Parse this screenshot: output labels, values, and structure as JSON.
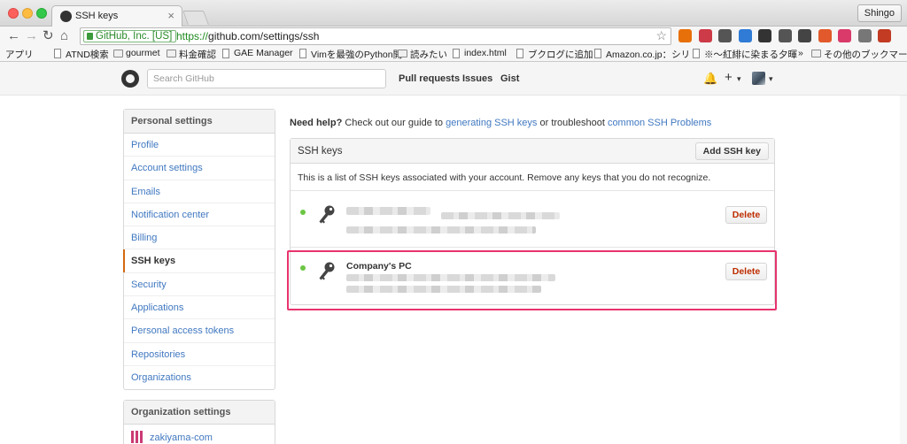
{
  "browser": {
    "tab_title": "SSH keys",
    "profile": "Shingo",
    "ev_label": "GitHub, Inc. [US]",
    "url_scheme": "https://",
    "url_rest": "github.com/settings/ssh",
    "extensions": [
      "ghostery-icon",
      "pocket-icon",
      "w-icon",
      "vimium-icon",
      "gear-icon",
      "cast-icon",
      "window-icon",
      "app-icon",
      "notes-icon",
      "evernote-icon",
      "gmail-icon",
      "boot-icon"
    ],
    "bookmarks": [
      {
        "label": "アプリ",
        "kind": "apps"
      },
      {
        "label": "ATND検索",
        "kind": "page"
      },
      {
        "label": "gourmet",
        "kind": "folder"
      },
      {
        "label": "料金確認",
        "kind": "folder"
      },
      {
        "label": "GAE Manager",
        "kind": "page"
      },
      {
        "label": "Vimを最強のPython開",
        "kind": "page"
      },
      {
        "label": "読みたい",
        "kind": "folder"
      },
      {
        "label": "index.html",
        "kind": "page"
      },
      {
        "label": "ブクログに追加",
        "kind": "page"
      },
      {
        "label": "Amazon.co.jp：シリ",
        "kind": "page"
      },
      {
        "label": "※〜紅緋に染まる夕暉",
        "kind": "page"
      },
      {
        "label": "»",
        "kind": "more"
      },
      {
        "label": "その他のブックマーク",
        "kind": "folder"
      }
    ]
  },
  "header": {
    "search_placeholder": "Search GitHub",
    "nav": [
      "Pull requests",
      "Issues",
      "Gist"
    ],
    "plus": "+",
    "caret": "▾"
  },
  "sidebar": {
    "personal_heading": "Personal settings",
    "items": [
      {
        "label": "Profile",
        "selected": false
      },
      {
        "label": "Account settings",
        "selected": false
      },
      {
        "label": "Emails",
        "selected": false
      },
      {
        "label": "Notification center",
        "selected": false
      },
      {
        "label": "Billing",
        "selected": false
      },
      {
        "label": "SSH keys",
        "selected": true
      },
      {
        "label": "Security",
        "selected": false
      },
      {
        "label": "Applications",
        "selected": false
      },
      {
        "label": "Personal access tokens",
        "selected": false
      },
      {
        "label": "Repositories",
        "selected": false
      },
      {
        "label": "Organizations",
        "selected": false
      }
    ],
    "org_heading": "Organization settings",
    "org_items": [
      "zakiyama-com"
    ]
  },
  "main": {
    "help_prefix": "Need help?",
    "help_text1": " Check out our guide to ",
    "help_link1": "generating SSH keys",
    "help_text2": " or troubleshoot ",
    "help_link2": "common SSH Problems",
    "panel_title": "SSH keys",
    "add_button": "Add SSH key",
    "description": "This is a list of SSH keys associated with your account. Remove any keys that you do not recognize.",
    "keys": [
      {
        "title": "",
        "delete": "Delete",
        "status": "active"
      },
      {
        "title": "Company's PC",
        "delete": "Delete",
        "status": "active"
      }
    ]
  },
  "colors": {
    "link": "#4078c0",
    "selected_marker": "#d26911",
    "delete_text": "#bd2c00",
    "active_dot": "#6cc644",
    "highlight_border": "#e8336d"
  }
}
